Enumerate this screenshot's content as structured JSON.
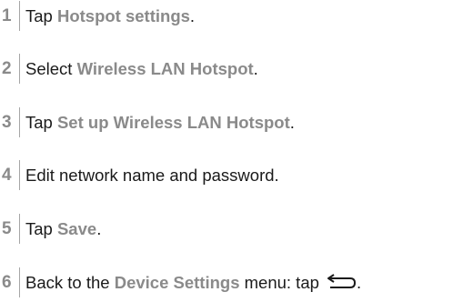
{
  "steps": [
    {
      "number": "1",
      "prefix": "Tap ",
      "highlight": "Hotspot settings",
      "suffix": "."
    },
    {
      "number": "2",
      "prefix": "Select ",
      "highlight": "Wireless LAN Hotspot",
      "suffix": "."
    },
    {
      "number": "3",
      "prefix": "Tap ",
      "highlight": "Set up Wireless LAN Hotspot",
      "suffix": "."
    },
    {
      "number": "4",
      "text": "Edit network name and password."
    },
    {
      "number": "5",
      "prefix": "Tap ",
      "highlight": "Save",
      "suffix": "."
    },
    {
      "number": "6",
      "prefix": "Back to the ",
      "highlight": "Device Settings",
      "suffix": " menu: tap ",
      "icon": "back-arrow-icon",
      "suffix2": "."
    }
  ],
  "colors": {
    "highlight": "#8a8a8a",
    "text": "#1a1a1a",
    "divider": "#a6a6a6"
  }
}
